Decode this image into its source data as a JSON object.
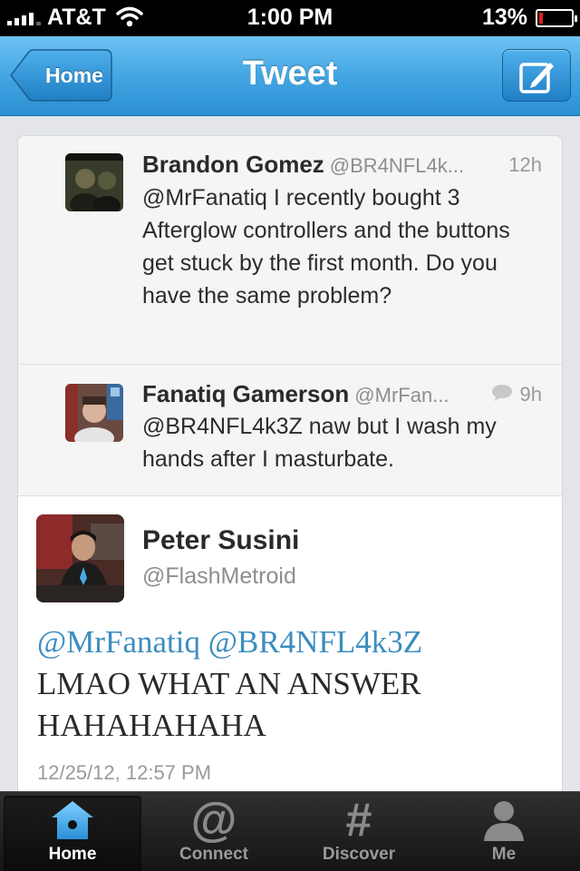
{
  "status_bar": {
    "carrier": "AT&T",
    "time": "1:00 PM",
    "battery": "13%",
    "battery_level": 0.13
  },
  "nav": {
    "back_label": "Home",
    "title": "Tweet",
    "compose_icon": "compose-icon"
  },
  "replies": [
    {
      "name": "Brandon Gomez",
      "handle": "@BR4NFL4k...",
      "time": "12h",
      "text": "@MrFanatiq I recently bought 3 Afterglow controllers and the buttons get stuck by the first month. Do you have the same problem?"
    },
    {
      "name": "Fanatiq Gamerson",
      "handle": "@MrFan...",
      "time": "9h",
      "time_icon": "conversation-bubble-icon",
      "text": "@BR4NFL4k3Z naw but I wash my hands after I masturbate."
    }
  ],
  "main_tweet": {
    "name": "Peter Susini",
    "handle": "@FlashMetroid",
    "mention_1": "@MrFanatiq",
    "mention_2": "@BR4NFL4k3Z",
    "text": "LMAO WHAT AN ANSWER HAHAHAHAHA",
    "date": "12/25/12, 12:57 PM"
  },
  "tabs": [
    {
      "label": "Home",
      "icon": "home-icon",
      "active": true
    },
    {
      "label": "Connect",
      "icon": "at-sign-icon",
      "active": false
    },
    {
      "label": "Discover",
      "icon": "hash-icon",
      "active": false
    },
    {
      "label": "Me",
      "icon": "person-icon",
      "active": false
    }
  ],
  "colors": {
    "nav_blue": "#45a7e3",
    "mention_blue": "#3c8dbf",
    "battery_red": "#e0211b"
  }
}
